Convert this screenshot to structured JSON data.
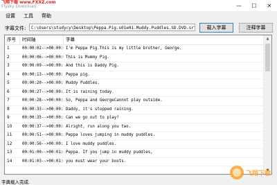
{
  "window": {
    "watermark_line1": "飞翔下载 www.FXXZ.com",
    "watermark_line2": "Flysky Download",
    "minimize": "—",
    "maximize": "☐",
    "close": "✕"
  },
  "menu": [
    "设置",
    "工具",
    "帮助"
  ],
  "file": {
    "label": "字幕文件:",
    "path": "C:\\Users\\studycy\\Desktop\\Peppa.Pig.s01e01.Muddy.Puddles.SD.DVD.srt",
    "load_button": "载入字幕",
    "save_button": "注释字幕"
  },
  "table": {
    "columns": [
      "序号",
      "时间轴",
      "字幕"
    ],
    "rows": [
      {
        "num": "1",
        "time": "00:00:02-->00:00:06",
        "text": "I'm Peppa Pig.This is my little brother, George."
      },
      {
        "num": "2",
        "time": "00:00:06-->00:00:08",
        "text": "This is Mummy Pig."
      },
      {
        "num": "3",
        "time": "00:00:09-->00:00:10",
        "text": "And this is Daddy Pig."
      },
      {
        "num": "4",
        "time": "00:00:13-->00:00:14",
        "text": "Peppa pig."
      },
      {
        "num": "5",
        "time": "00:00:20-->00:00:22",
        "text": "Muddy Puddles."
      },
      {
        "num": "6",
        "time": "00:00:27-->00:00:28",
        "text": "It is raining today."
      },
      {
        "num": "7",
        "time": "00:00:28-->00:00:31",
        "text": "So, Peppa and GeorgeCannot play outside."
      },
      {
        "num": "8",
        "time": "00:00:33-->00:00:35",
        "text": "Daddy, it's stopped raining."
      },
      {
        "num": "9",
        "time": "00:00:35-->00:00:37",
        "text": "Can we go out to play?"
      },
      {
        "num": "10",
        "time": "00:00:37-->00:00:40",
        "text": "Alright, run along you two."
      },
      {
        "num": "11",
        "time": "00:00:51-->00:00:53",
        "text": "Peppa loves jumping in muddy puddles."
      },
      {
        "num": "12",
        "time": "00:00:56-->00:00:58",
        "text": "I love muddy puddles."
      },
      {
        "num": "13",
        "time": "00:01:00-->00:01:03",
        "text": "Peppa.  If you jump in muddy puddles,"
      },
      {
        "num": "14",
        "time": "00:01:03-->00:01:04",
        "text": "you must wear your boots."
      }
    ]
  },
  "status": "字典载入完成.",
  "logo_text": "飞翔下载"
}
